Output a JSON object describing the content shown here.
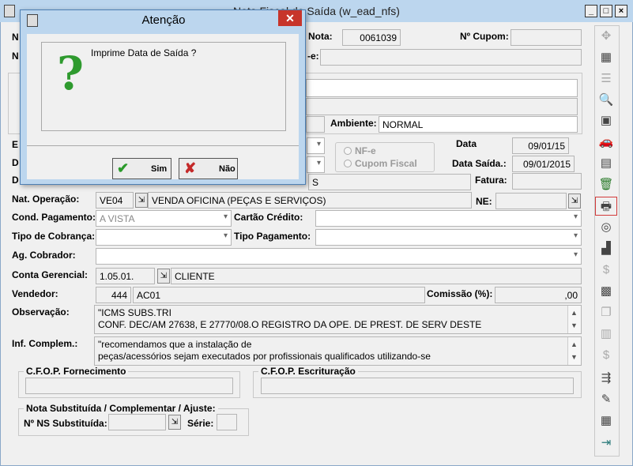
{
  "window": {
    "title": "Nota Fiscal de Saída (w_ead_nfs)",
    "hidden_title_prefix": "Nota Fiscal de Saída (w_ead_nfs)"
  },
  "labels": {
    "nota": "Nota:",
    "cupom": "Nº Cupom:",
    "nfe": "-e:",
    "ambiente": "Ambiente:",
    "data": "Data",
    "data_saida": "Data Saída.:",
    "fatura": "Fatura:",
    "nat_op": "Nat. Operação:",
    "ne": "NE:",
    "cond_pag": "Cond. Pagamento:",
    "cartao": "Cartão Crédito:",
    "tipo_cob": "Tipo de Cobrança:",
    "tipo_pag": "Tipo Pagamento:",
    "ag_cob": "Ag. Cobrador:",
    "conta_ger": "Conta Gerencial:",
    "vendedor": "Vendedor:",
    "comissao": "Comissão (%):",
    "observacao": "Observação:",
    "inf_compl": "Inf. Complem.:",
    "cfop_forn": "C.F.O.P. Fornecimento",
    "cfop_escr": "C.F.O.P. Escrituração",
    "nota_subst": "Nota Substituída / Complementar / Ajuste:",
    "ns_subst": "Nº NS Substituída:",
    "serie": "Série:",
    "left_n1": "N",
    "left_n2": "N",
    "left_e": "E",
    "left_d1": "D",
    "left_d2": "D"
  },
  "values": {
    "nota": "0061039",
    "ambiente": "NORMAL",
    "data": "09/01/15",
    "data_saida": "09/01/2015",
    "nat_op_code": "VE04",
    "nat_op_desc": "VENDA OFICINA (PEÇAS E SERVIÇOS)",
    "cond_pag": "A VISTA",
    "conta_ger_code": "1.05.01.",
    "conta_ger_desc": "CLIENTE",
    "vendedor_code": "444",
    "vendedor_name": "AC01",
    "comissao": ",00",
    "obs_line1": "\"ICMS SUBS.TRI",
    "obs_line2": "CONF. DEC/AM 27638, E 27770/08.O REGISTRO DA OPE. DE  PREST. DE SERV DESTE",
    "inf_line1": "\"recomendamos que a instalação de",
    "inf_line2": "peças/acessórios sejam executados por profissionais qualificados utilizando-se",
    "radio_nfe": "NF-e",
    "radio_cupom": "Cupom Fiscal",
    "partial_s": "S"
  },
  "dialog": {
    "title": "Atenção",
    "message": "Imprime Data de Saída ?",
    "yes": "Sim",
    "no": "Não"
  },
  "toolbar": {
    "icons": [
      "move-icon",
      "spreadsheet-icon",
      "list-icon",
      "preview-icon",
      "gift-icon",
      "car-icon",
      "print-stack-icon",
      "trash-icon",
      "printer-icon",
      "coins-icon",
      "cashier-icon",
      "dollar-icon",
      "calculator-icon",
      "copy-icon",
      "columns-icon",
      "dollar2-icon",
      "export-icon",
      "tools-icon",
      "table-icon",
      "exit-icon"
    ]
  }
}
